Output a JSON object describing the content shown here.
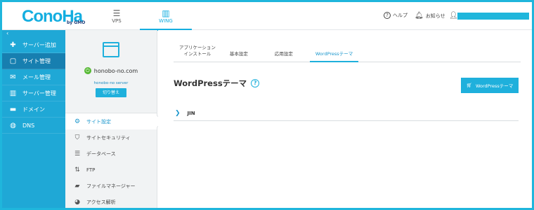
{
  "brand": {
    "logo": "ConoHa",
    "logo_sub": "by GMO"
  },
  "top_tabs": [
    {
      "label": "VPS",
      "icon": "server-stack-icon"
    },
    {
      "label": "WING",
      "icon": "building-icon"
    }
  ],
  "header_links": {
    "help": "ヘルプ",
    "notifications": "お知らせ"
  },
  "left_nav": [
    {
      "label": "サーバー追加",
      "icon": "plus-icon"
    },
    {
      "label": "サイト管理",
      "icon": "window-icon"
    },
    {
      "label": "メール管理",
      "icon": "envelope-icon"
    },
    {
      "label": "サーバー管理",
      "icon": "building-icon"
    },
    {
      "label": "ドメイン",
      "icon": "id-card-icon"
    },
    {
      "label": "DNS",
      "icon": "globe-icon"
    }
  ],
  "server": {
    "name": "honobo-no.com",
    "label": "honobo-no server",
    "switch_label": "切り替え",
    "status_color": "#55b832"
  },
  "sub_nav": [
    {
      "label": "サイト設定",
      "icon": "site-settings-icon"
    },
    {
      "label": "サイトセキュリティ",
      "icon": "shield-icon"
    },
    {
      "label": "データベース",
      "icon": "database-icon"
    },
    {
      "label": "FTP",
      "icon": "transfer-arrows-icon"
    },
    {
      "label": "ファイルマネージャー",
      "icon": "folder-icon"
    },
    {
      "label": "アクセス解析",
      "icon": "pie-chart-icon"
    }
  ],
  "tabs": [
    {
      "label": "アプリケーション\nインストール"
    },
    {
      "label": "基本設定"
    },
    {
      "label": "応用設定"
    },
    {
      "label": "WordPressテーマ"
    }
  ],
  "page": {
    "title": "WordPressテーマ",
    "button_label": "WordPressテーマ",
    "themes": [
      {
        "name": "JIN"
      }
    ]
  },
  "colors": {
    "accent": "#1fb0dc",
    "nav_bg": "#1fa8d6",
    "nav_active": "#177fb0"
  }
}
